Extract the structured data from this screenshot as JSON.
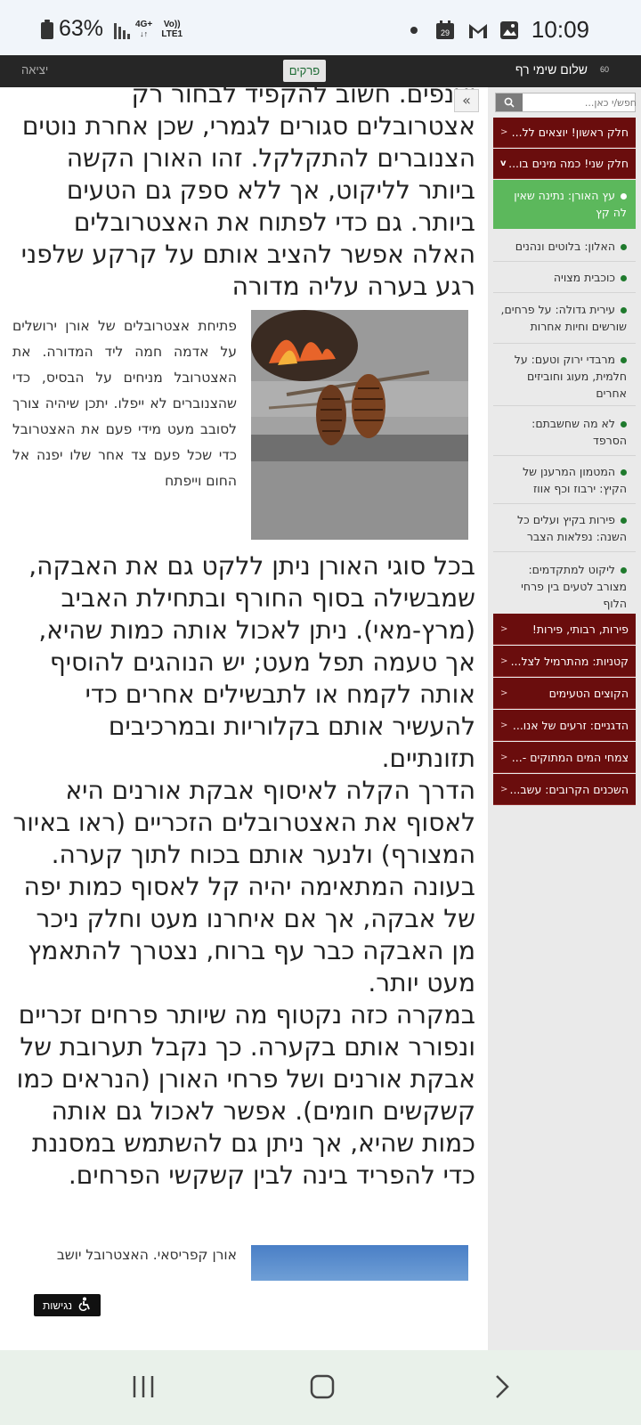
{
  "status_bar": {
    "battery": "63%",
    "network_top": "4G+",
    "network_label": "Vo)) LTE1",
    "time": "10:09",
    "calendar_day": "29"
  },
  "top_nav": {
    "logout": "יציאה",
    "chapters": "פרקים",
    "greeting": "שלום שימי רף",
    "badge": "60"
  },
  "article": {
    "para_top": "יענפים. חשוב להקפיד לבחור רק אצטרובלים סגורים לגמרי, שכן אחרת נוטים הצנוברים להתקלקל. זהו האורן הקשה ביותר לליקוט, אך ללא ספק גם הטעים ביותר. גם כדי לפתוח את האצטרובלים האלה אפשר להציב אותם על קרקע שלפני רגע בערה עליה מדורה",
    "figure_caption": "פתיחת אצטרובלים של אורן ירושלים על אדמה חמה ליד המדורה. את האצטרובל מניחים על הבסיס, כדי שהצנוברים לא ייפלו. יתכן שיהיה צורך לסובב מעט מידי פעם את האצטרובל כדי שכל פעם צד אחר שלו יפנה אל החום וייפתח",
    "para_2": "בכל סוגי האורן ניתן ללקט גם את האבקה, שמבשילה בסוף החורף ובתחילת האביב (מרץ-מאי). ניתן לאכול אותה כמות שהיא, אך טעמה תפל מעט; יש הנוהגים להוסיף אותה לקמח או לתבשילים אחרים כדי להעשיר אותם בקלוריות ובמרכיבים תזונתיים.",
    "para_3": "הדרך הקלה לאיסוף אבקת אורנים היא לאסוף את האצטרובלים הזכריים (ראו באיור המצורף) ולנער אותם בכוח לתוך קערה. בעונה המתאימה יהיה קל לאסוף כמות יפה של אבקה, אך אם איחרנו מעט וחלק ניכר מן האבקה כבר עף ברוח, נצטרך להתאמץ מעט יותר.",
    "para_4": "במקרה כזה נקטוף מה שיותר פרחים זכריים ונפורר אותם בקערה. כך נקבל תערובת של אבקת אורנים ושל פרחי האורן (הנראים כמו קשקשים חומים). אפשר לאכול גם אותה כמות שהיא, אך ניתן גם להשתמש במסננת כדי להפריד בינה לבין קשקשי הפרחים.",
    "second_caption": "אורן קפריסאי. האצטרובל יושב",
    "accessibility": "נגישות"
  },
  "sidebar": {
    "search_placeholder": "חפש/י כאן...",
    "part1": "חלק ראשון! יוצאים לל...",
    "part2": "חלק שני! כמה מינים בו...",
    "active_item": "עץ האורן: נתינה שאין לה קץ",
    "items": [
      "האלון: בלוטים ונהנים",
      "כוכבית מצויה",
      "עירית גדולה: על פרחים, שורשים וחיות אחרות",
      "מרבדי ירוק וטעם: על חלמית, מעוג וחוביזים אחרים",
      "לא מה שחשבתם: הסרפד",
      "המטמון המרענן של הקיץ: ירבוז וכף אווז",
      "פירות בקיץ ועלים כל השנה: נפלאות הצבר",
      "ליקוט למתקדמים: מצורב לטעים בין פרחי הלוף"
    ],
    "bottom_sections": [
      "פירות, רבותי, פירות!",
      "קטניות: מהתרמיל לצל...",
      "הקוצים הטעימים",
      "הדגניים: זרעים של אנו...",
      "צמחי המים המתוקים -...",
      "השכנים הקרובים: עשב..."
    ]
  },
  "colors": {
    "sidebar_dark": "#6a0d0d",
    "sidebar_active": "#5cb85c",
    "topnav_bg": "#262626"
  }
}
